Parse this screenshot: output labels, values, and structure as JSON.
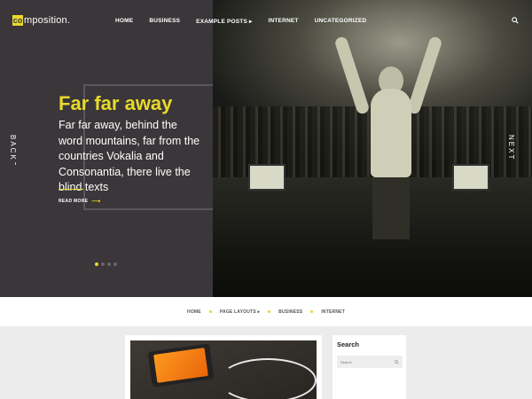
{
  "header": {
    "logo_mark": "co",
    "logo_text": "mposition.",
    "nav": [
      {
        "label": "HOME"
      },
      {
        "label": "BUSINESS"
      },
      {
        "label": "EXAMPLE POSTS ▸"
      },
      {
        "label": "INTERNET"
      },
      {
        "label": "UNCATEGORIZED"
      }
    ]
  },
  "slider": {
    "title": "Far far away",
    "text": "Far far away, behind the word mountains, far from the countries Vokalia and Consonantia, there live the blind texts",
    "read_more": "READ MORE",
    "read_more_arrow": "⟶",
    "prev_label": "BACK",
    "next_label": "NEXT",
    "slide_count": 4,
    "active_slide": 1
  },
  "subnav": [
    {
      "label": "HOME"
    },
    {
      "label": "PAGE LAYOUTS ▸"
    },
    {
      "label": "BUSINESS"
    },
    {
      "label": "INTERNET"
    }
  ],
  "sidebar": {
    "search_title": "Search",
    "search_placeholder": "Search"
  },
  "colors": {
    "accent": "#e8d92c",
    "hero_dark": "#3a3639",
    "page_bg": "#ececec"
  }
}
